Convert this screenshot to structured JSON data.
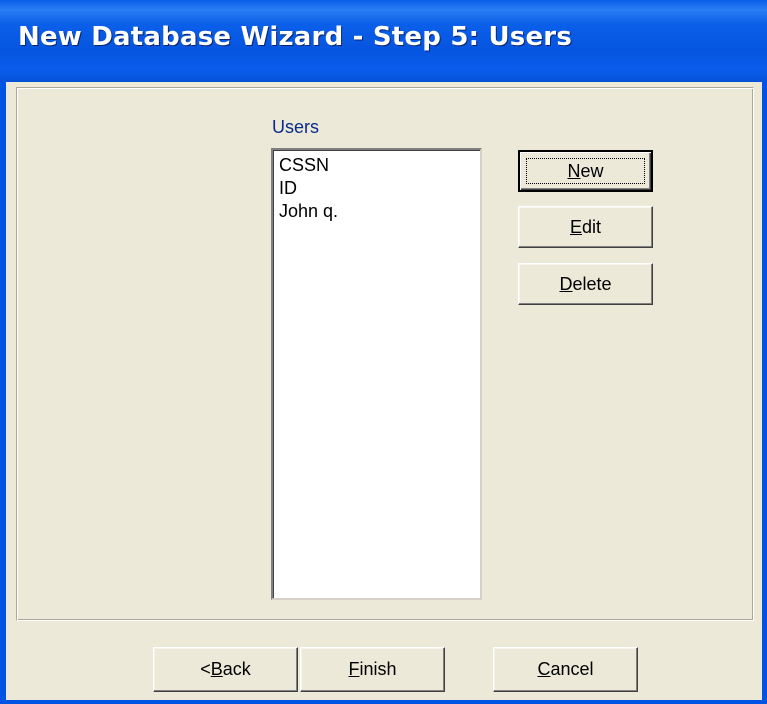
{
  "window": {
    "title": "New Database Wizard - Step 5: Users"
  },
  "users": {
    "label": "Users",
    "items": [
      "CSSN",
      "ID",
      "John q."
    ]
  },
  "side_buttons": {
    "new": {
      "mnemonic": "N",
      "rest": "ew"
    },
    "edit": {
      "mnemonic": "E",
      "rest": "dit"
    },
    "delete": {
      "mnemonic": "D",
      "rest": "elete"
    }
  },
  "footer_buttons": {
    "back": {
      "prefix": "<",
      "mnemonic": "B",
      "rest": "ack"
    },
    "finish": {
      "mnemonic": "F",
      "rest": "inish"
    },
    "cancel": {
      "mnemonic": "C",
      "rest": "ancel"
    }
  },
  "colors": {
    "titlebar": "#0a5fe8",
    "dialog_bg": "#ece9d8",
    "label_text": "#0a2a8c"
  }
}
